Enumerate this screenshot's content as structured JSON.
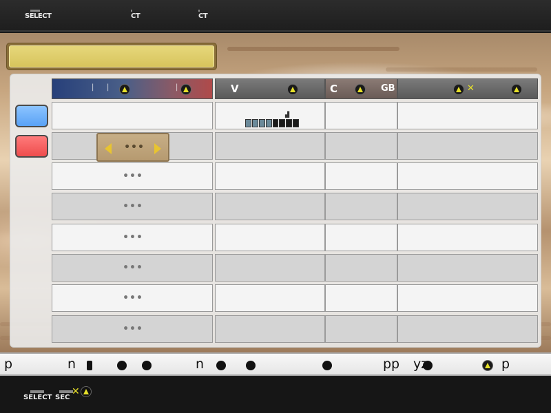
{
  "top_bar": {
    "items": [
      {
        "label": "SELECT"
      },
      {
        "label": "CT"
      },
      {
        "label": "CT"
      }
    ]
  },
  "title_slot": {
    "text": ""
  },
  "table": {
    "headers": [
      {
        "label": "",
        "hint": "△"
      },
      {
        "label": "V",
        "hint": "△"
      },
      {
        "label": "C",
        "sub": "GB",
        "hint": "△"
      },
      {
        "label": "",
        "hint": "△ ✕"
      }
    ],
    "rows": [
      {
        "col1": "",
        "volume_label": "",
        "meter_on": 4,
        "meter_total": 8
      },
      {
        "col1": "•••"
      },
      {
        "col1": "•••"
      },
      {
        "col1": "•••"
      },
      {
        "col1": "•••"
      },
      {
        "col1": "•••"
      },
      {
        "col1": "•••"
      },
      {
        "col1": "•••"
      }
    ]
  },
  "side_buttons": [
    {
      "color": "#6fb2ff"
    },
    {
      "color": "#f25a5a"
    }
  ],
  "instruction_bar": {
    "tokens": [
      "p",
      "n",
      "n",
      "pp",
      "yz",
      "p"
    ]
  },
  "bottom_bar": {
    "items": [
      {
        "label": "SELECT"
      },
      {
        "label": "SEC"
      }
    ]
  },
  "colors": {
    "accent_yellow": "#e6e02a",
    "header_blue": "#27407a",
    "header_red": "#b04a4a"
  }
}
